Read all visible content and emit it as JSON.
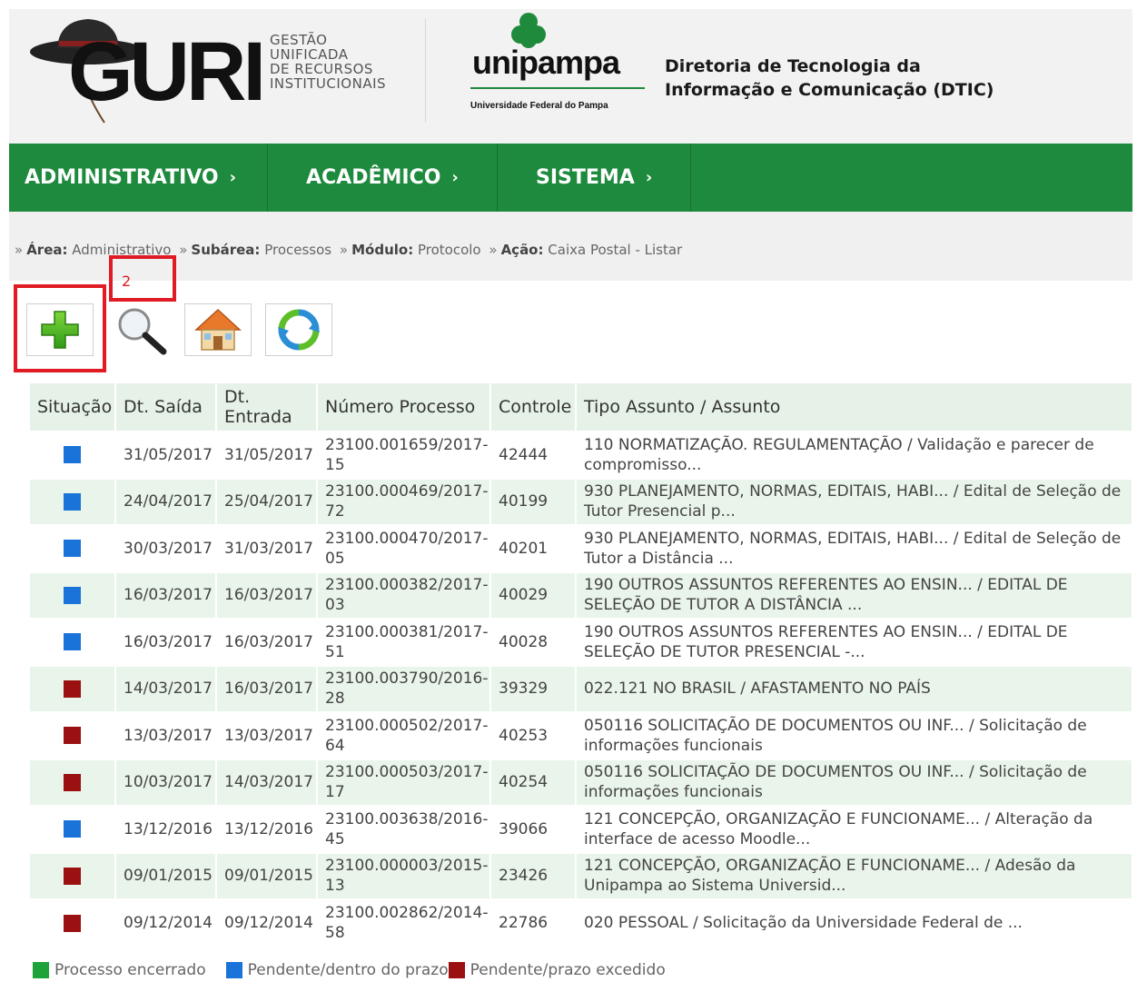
{
  "header": {
    "guri_word": "GURI",
    "guri_sub": [
      "GESTÃO",
      "UNIFICADA",
      "DE RECURSOS",
      "INSTITUCIONAIS"
    ],
    "unipampa_word": "unipampa",
    "unipampa_sub": "Universidade Federal do Pampa",
    "dtic_line1": "Diretoria de Tecnologia da",
    "dtic_line2": "Informação e Comunicação (DTIC)"
  },
  "nav": {
    "items": [
      {
        "label": "ADMINISTRATIVO",
        "chev": "›"
      },
      {
        "label": "ACADÊMICO",
        "chev": "›"
      },
      {
        "label": "SISTEMA",
        "chev": "›"
      }
    ]
  },
  "breadcrumb": {
    "lead": "»",
    "sep": "»",
    "area_label": "Área:",
    "area_value": "Administrativo",
    "subarea_label": "Subárea:",
    "subarea_value": "Processos",
    "modulo_label": "Módulo:",
    "modulo_value": "Protocolo",
    "acao_label": "Ação:",
    "acao_value": "Caixa Postal - Listar"
  },
  "annotations": {
    "box2_label": "2"
  },
  "toolbar": {
    "icons": [
      "plus-icon",
      "magnifier-icon",
      "home-icon",
      "refresh-icon"
    ]
  },
  "table": {
    "headers": [
      "Situação",
      "Dt. Saída",
      "Dt. Entrada",
      "Número Processo",
      "Controle",
      "Tipo Assunto / Assunto"
    ],
    "rows": [
      {
        "status": "pendente",
        "saida": "31/05/2017",
        "entrada": "31/05/2017",
        "numero": "23100.001659/2017-15",
        "controle": "42444",
        "assunto": "110 NORMATIZAÇÃO. REGULAMENTAÇÃO / Validação e parecer de compromisso..."
      },
      {
        "status": "pendente",
        "saida": "24/04/2017",
        "entrada": "25/04/2017",
        "numero": "23100.000469/2017-72",
        "controle": "40199",
        "assunto": "930 PLANEJAMENTO, NORMAS, EDITAIS, HABI... / Edital de Seleção de Tutor Presencial p..."
      },
      {
        "status": "pendente",
        "saida": "30/03/2017",
        "entrada": "31/03/2017",
        "numero": "23100.000470/2017-05",
        "controle": "40201",
        "assunto": "930 PLANEJAMENTO, NORMAS, EDITAIS, HABI... / Edital de Seleção de Tutor a Distância ..."
      },
      {
        "status": "pendente",
        "saida": "16/03/2017",
        "entrada": "16/03/2017",
        "numero": "23100.000382/2017-03",
        "controle": "40029",
        "assunto": "190 OUTROS ASSUNTOS REFERENTES AO ENSIN... / EDITAL DE SELEÇÃO DE TUTOR A DISTÂNCIA ..."
      },
      {
        "status": "pendente",
        "saida": "16/03/2017",
        "entrada": "16/03/2017",
        "numero": "23100.000381/2017-51",
        "controle": "40028",
        "assunto": "190 OUTROS ASSUNTOS REFERENTES AO ENSIN... / EDITAL DE SELEÇÃO DE TUTOR PRESENCIAL -..."
      },
      {
        "status": "excedido",
        "saida": "14/03/2017",
        "entrada": "16/03/2017",
        "numero": "23100.003790/2016-28",
        "controle": "39329",
        "assunto": "022.121 NO BRASIL / AFASTAMENTO NO PAÍS"
      },
      {
        "status": "excedido",
        "saida": "13/03/2017",
        "entrada": "13/03/2017",
        "numero": "23100.000502/2017-64",
        "controle": "40253",
        "assunto": "050116 SOLICITAÇÃO DE DOCUMENTOS OU INF... / Solicitação de informações funcionais"
      },
      {
        "status": "excedido",
        "saida": "10/03/2017",
        "entrada": "14/03/2017",
        "numero": "23100.000503/2017-17",
        "controle": "40254",
        "assunto": "050116 SOLICITAÇÃO DE DOCUMENTOS OU INF... / Solicitação de informações funcionais"
      },
      {
        "status": "pendente",
        "saida": "13/12/2016",
        "entrada": "13/12/2016",
        "numero": "23100.003638/2016-45",
        "controle": "39066",
        "assunto": "121 CONCEPÇÃO, ORGANIZAÇÃO E FUNCIONAME... / Alteração da interface de acesso Moodle..."
      },
      {
        "status": "excedido",
        "saida": "09/01/2015",
        "entrada": "09/01/2015",
        "numero": "23100.000003/2015-13",
        "controle": "23426",
        "assunto": "121 CONCEPÇÃO, ORGANIZAÇÃO E FUNCIONAME... / Adesão da Unipampa ao Sistema Universid..."
      },
      {
        "status": "excedido",
        "saida": "09/12/2014",
        "entrada": "09/12/2014",
        "numero": "23100.002862/2014-58",
        "controle": "22786",
        "assunto": "020 PESSOAL / Solicitação da Universidade Federal de ..."
      }
    ]
  },
  "status_colors": {
    "encerrado": "#1ea33b",
    "pendente": "#1a73d9",
    "excedido": "#9b1111"
  },
  "legend": {
    "encerrado": "Processo encerrado",
    "pendente": "Pendente/dentro do prazo",
    "excedido": "Pendente/prazo excedido"
  }
}
